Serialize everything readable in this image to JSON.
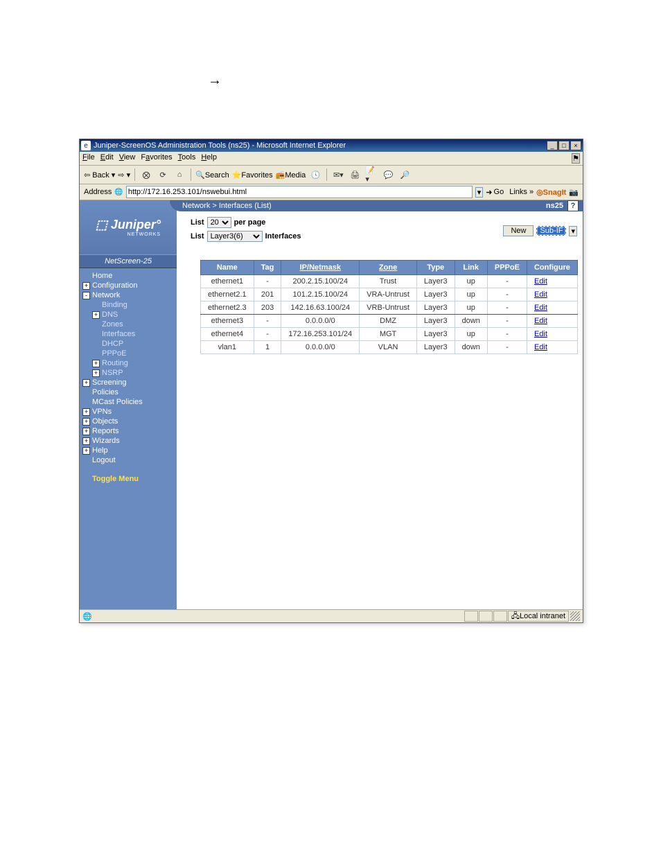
{
  "arrow": "→",
  "window": {
    "title": "Juniper-ScreenOS Administration Tools (ns25) - Microsoft Internet Explorer",
    "min": "_",
    "max": "□",
    "close": "×"
  },
  "menus": {
    "file": "File",
    "edit": "Edit",
    "view": "View",
    "favorites": "Favorites",
    "tools": "Tools",
    "help": "Help"
  },
  "toolbar": {
    "back": "Back",
    "search": "Search",
    "favorites": "Favorites",
    "media": "Media"
  },
  "address": {
    "label": "Address",
    "url": "http://172.16.253.101/nswebui.html",
    "go": "Go",
    "links": "Links »",
    "snagit": "SnagIt"
  },
  "logo": "Juniper",
  "logo_sub": "NETWORKS",
  "device_model": "NetScreen-25",
  "nav": {
    "home": "Home",
    "configuration": "Configuration",
    "network": "Network",
    "binding": "Binding",
    "dns": "DNS",
    "zones": "Zones",
    "interfaces": "Interfaces",
    "dhcp": "DHCP",
    "pppoe": "PPPoE",
    "routing": "Routing",
    "nsrp": "NSRP",
    "screening": "Screening",
    "policies": "Policies",
    "mcast": "MCast Policies",
    "vpns": "VPNs",
    "objects": "Objects",
    "reports": "Reports",
    "wizards": "Wizards",
    "help": "Help",
    "logout": "Logout",
    "toggle": "Toggle Menu"
  },
  "breadcrumb": "Network > Interfaces (List)",
  "device_name": "ns25",
  "list": {
    "list_label": "List",
    "per_page_value": "20",
    "per_page_suffix": "per page",
    "filter_label": "List",
    "filter_value": "Layer3(6)",
    "filter_suffix": "Interfaces",
    "new": "New",
    "subif": "Sub-IF"
  },
  "headers": {
    "name": "Name",
    "tag": "Tag",
    "ip": "IP/Netmask",
    "zone": "Zone",
    "type": "Type",
    "link": "Link",
    "pppoe": "PPPoE",
    "configure": "Configure"
  },
  "rows": [
    {
      "name": "ethernet1",
      "tag": "-",
      "ip": "200.2.15.100/24",
      "zone": "Trust",
      "type": "Layer3",
      "link": "up",
      "pppoe": "-",
      "cfg": "Edit"
    },
    {
      "name": "ethernet2.1",
      "tag": "201",
      "ip": "101.2.15.100/24",
      "zone": "VRA-Untrust",
      "type": "Layer3",
      "link": "up",
      "pppoe": "-",
      "cfg": "Edit"
    },
    {
      "name": "ethernet2.3",
      "tag": "203",
      "ip": "142.16.63.100/24",
      "zone": "VRB-Untrust",
      "type": "Layer3",
      "link": "up",
      "pppoe": "-",
      "cfg": "Edit",
      "hl": true
    },
    {
      "name": "ethernet3",
      "tag": "-",
      "ip": "0.0.0.0/0",
      "zone": "DMZ",
      "type": "Layer3",
      "link": "down",
      "pppoe": "-",
      "cfg": "Edit"
    },
    {
      "name": "ethernet4",
      "tag": "-",
      "ip": "172.16.253.101/24",
      "zone": "MGT",
      "type": "Layer3",
      "link": "up",
      "pppoe": "-",
      "cfg": "Edit"
    },
    {
      "name": "vlan1",
      "tag": "1",
      "ip": "0.0.0.0/0",
      "zone": "VLAN",
      "type": "Layer3",
      "link": "down",
      "pppoe": "-",
      "cfg": "Edit"
    }
  ],
  "statusbar": {
    "zone": "Local intranet"
  }
}
